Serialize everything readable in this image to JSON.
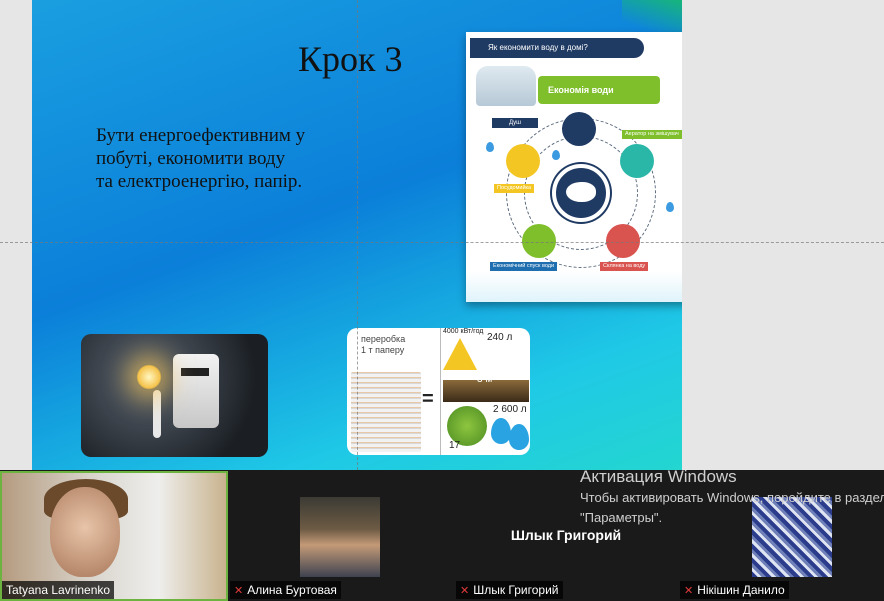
{
  "slide": {
    "title": "Крок 3",
    "body": " Бути енергоефективним у побуті, економити воду та електроенергію, папір.",
    "infographic": {
      "header": "Як економити воду в домі?",
      "bubble": "Економія води",
      "labels": [
        "Душ",
        "Аератор на змішувач",
        "Посудомийка",
        "Економічний спуск води",
        "Склянка на воду"
      ]
    },
    "paper_image": {
      "caption_line1": "переробка",
      "caption_line2": "1 т паперу",
      "energy": "4000 кВт/год",
      "oil": "240 л",
      "soil": "3 м³",
      "water": "2 600 л",
      "trees": "17"
    }
  },
  "activation": {
    "title": "Активация Windows",
    "text": "Чтобы активировать Windows, перейдите в раздел \"Параметры\"."
  },
  "participants": [
    {
      "name": "Tatyana Lavrinenko",
      "muted": false
    },
    {
      "name": "Алина Буртовая",
      "muted": true
    },
    {
      "name": "Шлык Григорий",
      "muted": true,
      "display_name": "Шлык Григорий"
    },
    {
      "name": "Нікішин Данило",
      "muted": true
    }
  ],
  "colors": {
    "accent": "#6db33f",
    "mic_off": "#e23b3b"
  }
}
